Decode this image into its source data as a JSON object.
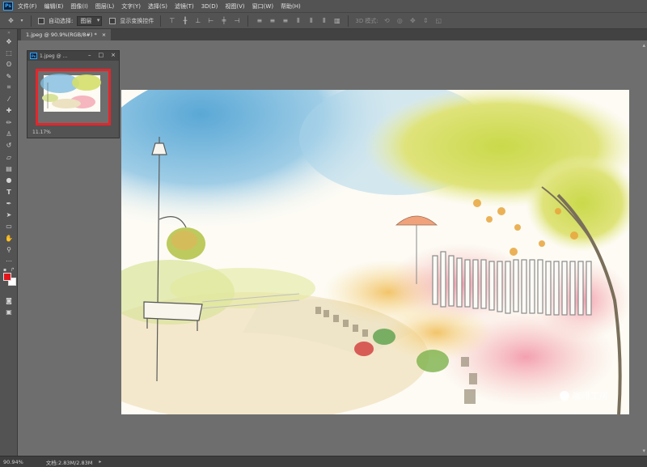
{
  "menu": {
    "app_badge": "Ps",
    "items": [
      "文件(F)",
      "编辑(E)",
      "图像(I)",
      "图层(L)",
      "文字(Y)",
      "选择(S)",
      "滤镜(T)",
      "3D(D)",
      "视图(V)",
      "窗口(W)",
      "帮助(H)"
    ]
  },
  "options": {
    "auto_select_label": "自动选择:",
    "auto_select_value": "图层",
    "show_transform_label": "显示变换控件",
    "mode_3d_label": "3D 模式:"
  },
  "document": {
    "tab_title": "1.jpeg @ 90.9%(RGB/8#) *",
    "tab_close": "×"
  },
  "navigator": {
    "title": "1.jpeg @ ...",
    "zoom": "11.17%"
  },
  "status": {
    "zoom": "90.94%",
    "doc_label": "文档:2.83M/2.83M"
  },
  "watermark": "咖啡工房",
  "colors": {
    "foreground": "#e3151b",
    "background": "#ffffff",
    "highlight": "#e3262b"
  }
}
